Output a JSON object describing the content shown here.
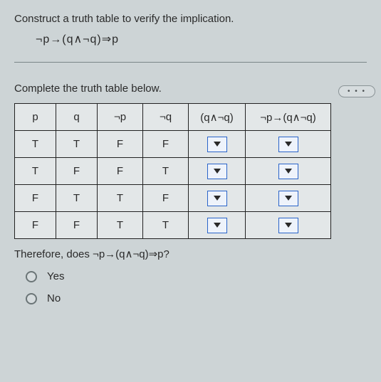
{
  "instruction": "Construct a truth table to verify the implication.",
  "formula": "¬p→(q∧¬q)⇒p",
  "subhead": "Complete the truth table below.",
  "ellipsis": "• • •",
  "headers": {
    "p": "p",
    "q": "q",
    "notp": "¬p",
    "notq": "¬q",
    "qandnotq": "(q∧¬q)",
    "impl": "¬p→(q∧¬q)"
  },
  "rows": [
    {
      "p": "T",
      "q": "T",
      "notp": "F",
      "notq": "F"
    },
    {
      "p": "T",
      "q": "F",
      "notp": "F",
      "notq": "T"
    },
    {
      "p": "F",
      "q": "T",
      "notp": "T",
      "notq": "F"
    },
    {
      "p": "F",
      "q": "F",
      "notp": "T",
      "notq": "T"
    }
  ],
  "question": "Therefore, does ¬p→(q∧¬q)⇒p?",
  "options": {
    "yes": "Yes",
    "no": "No"
  }
}
